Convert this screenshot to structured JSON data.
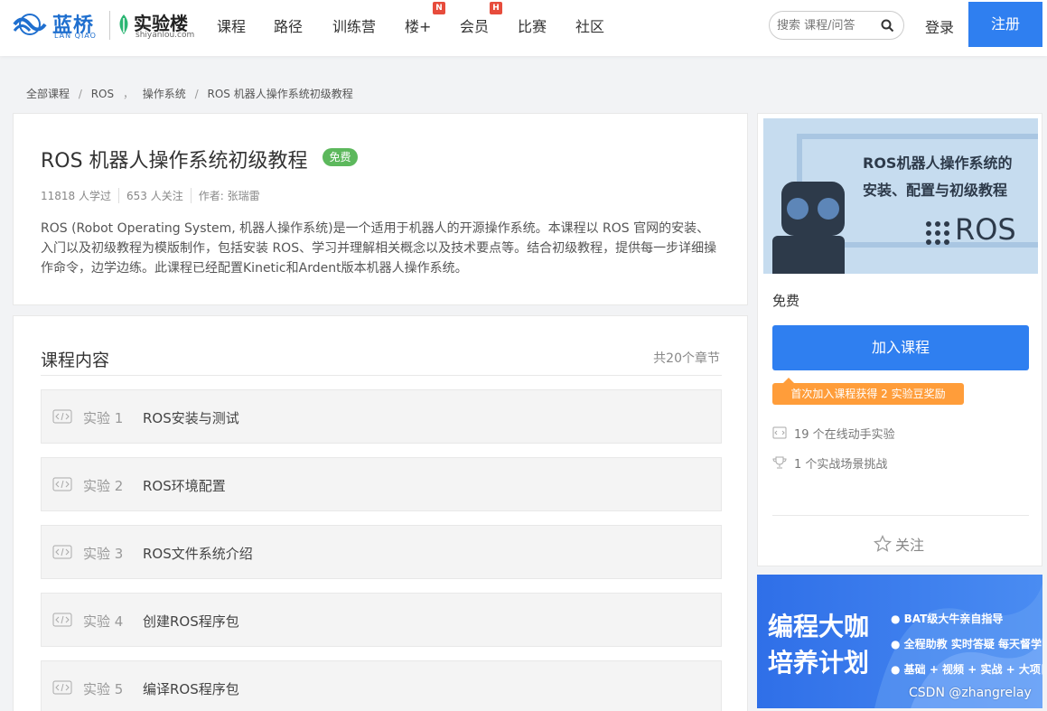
{
  "header": {
    "logo_lanqiao": "蓝桥",
    "logo_lanqiao_sub": "LAN QIAO",
    "logo_shiyanlou": "实验楼",
    "logo_shiyanlou_sub": "shiyanlou.com",
    "nav": [
      {
        "label": "课程"
      },
      {
        "label": "路径"
      },
      {
        "label": "训练营"
      },
      {
        "label": "楼+",
        "badge": "N"
      },
      {
        "label": "会员",
        "badge": "H"
      },
      {
        "label": "比赛"
      },
      {
        "label": "社区"
      }
    ],
    "search_placeholder": "搜索 课程/问答",
    "login": "登录",
    "register": "注册"
  },
  "breadcrumb": [
    "全部课程",
    "/",
    "ROS",
    "，",
    "操作系统",
    "/",
    "ROS 机器人操作系统初级教程"
  ],
  "course": {
    "title": "ROS 机器人操作系统初级教程",
    "badge": "免费",
    "stats": [
      "11818 人学过",
      "653 人关注",
      "作者: 张瑞雷"
    ],
    "description": "ROS (Robot Operating System, 机器人操作系统)是一个适用于机器人的开源操作系统。本课程以 ROS 官网的安装、入门以及初级教程为模版制作，包括安装 ROS、学习并理解相关概念以及技术要点等。结合初级教程，提供每一步详细操作命令，边学边练。此课程已经配置Kinetic和Ardent版本机器人操作系统。"
  },
  "content": {
    "title": "课程内容",
    "count": "共20个章节",
    "labs": [
      {
        "num": "实验 1",
        "name": "ROS安装与测试"
      },
      {
        "num": "实验 2",
        "name": "ROS环境配置"
      },
      {
        "num": "实验 3",
        "name": "ROS文件系统介绍"
      },
      {
        "num": "实验 4",
        "name": "创建ROS程序包"
      },
      {
        "num": "实验 5",
        "name": "编译ROS程序包"
      }
    ]
  },
  "sidebar": {
    "banner_line1": "ROS机器人操作系统的",
    "banner_line2": "安装、配置与初级教程",
    "banner_logo": "ROS",
    "price": "免费",
    "join": "加入课程",
    "reward": "首次加入课程获得 2 实验豆奖励",
    "features": [
      "19 个在线动手实验",
      "1 个实战场景挑战"
    ],
    "follow": "关注"
  },
  "ad": {
    "title1": "编程大咖",
    "title2": "培养计划",
    "points": [
      "● BAT级大牛亲自指导",
      "● 全程助教 实时答疑 每天督学",
      "● 基础 + 视频 + 实战 + 大项目"
    ]
  },
  "watermark": "CSDN @zhangrelay",
  "colors": {
    "primary": "#2f7ff0",
    "free": "#5cb85c",
    "reward": "#ff9d3a",
    "badge": "#e74c3c"
  }
}
